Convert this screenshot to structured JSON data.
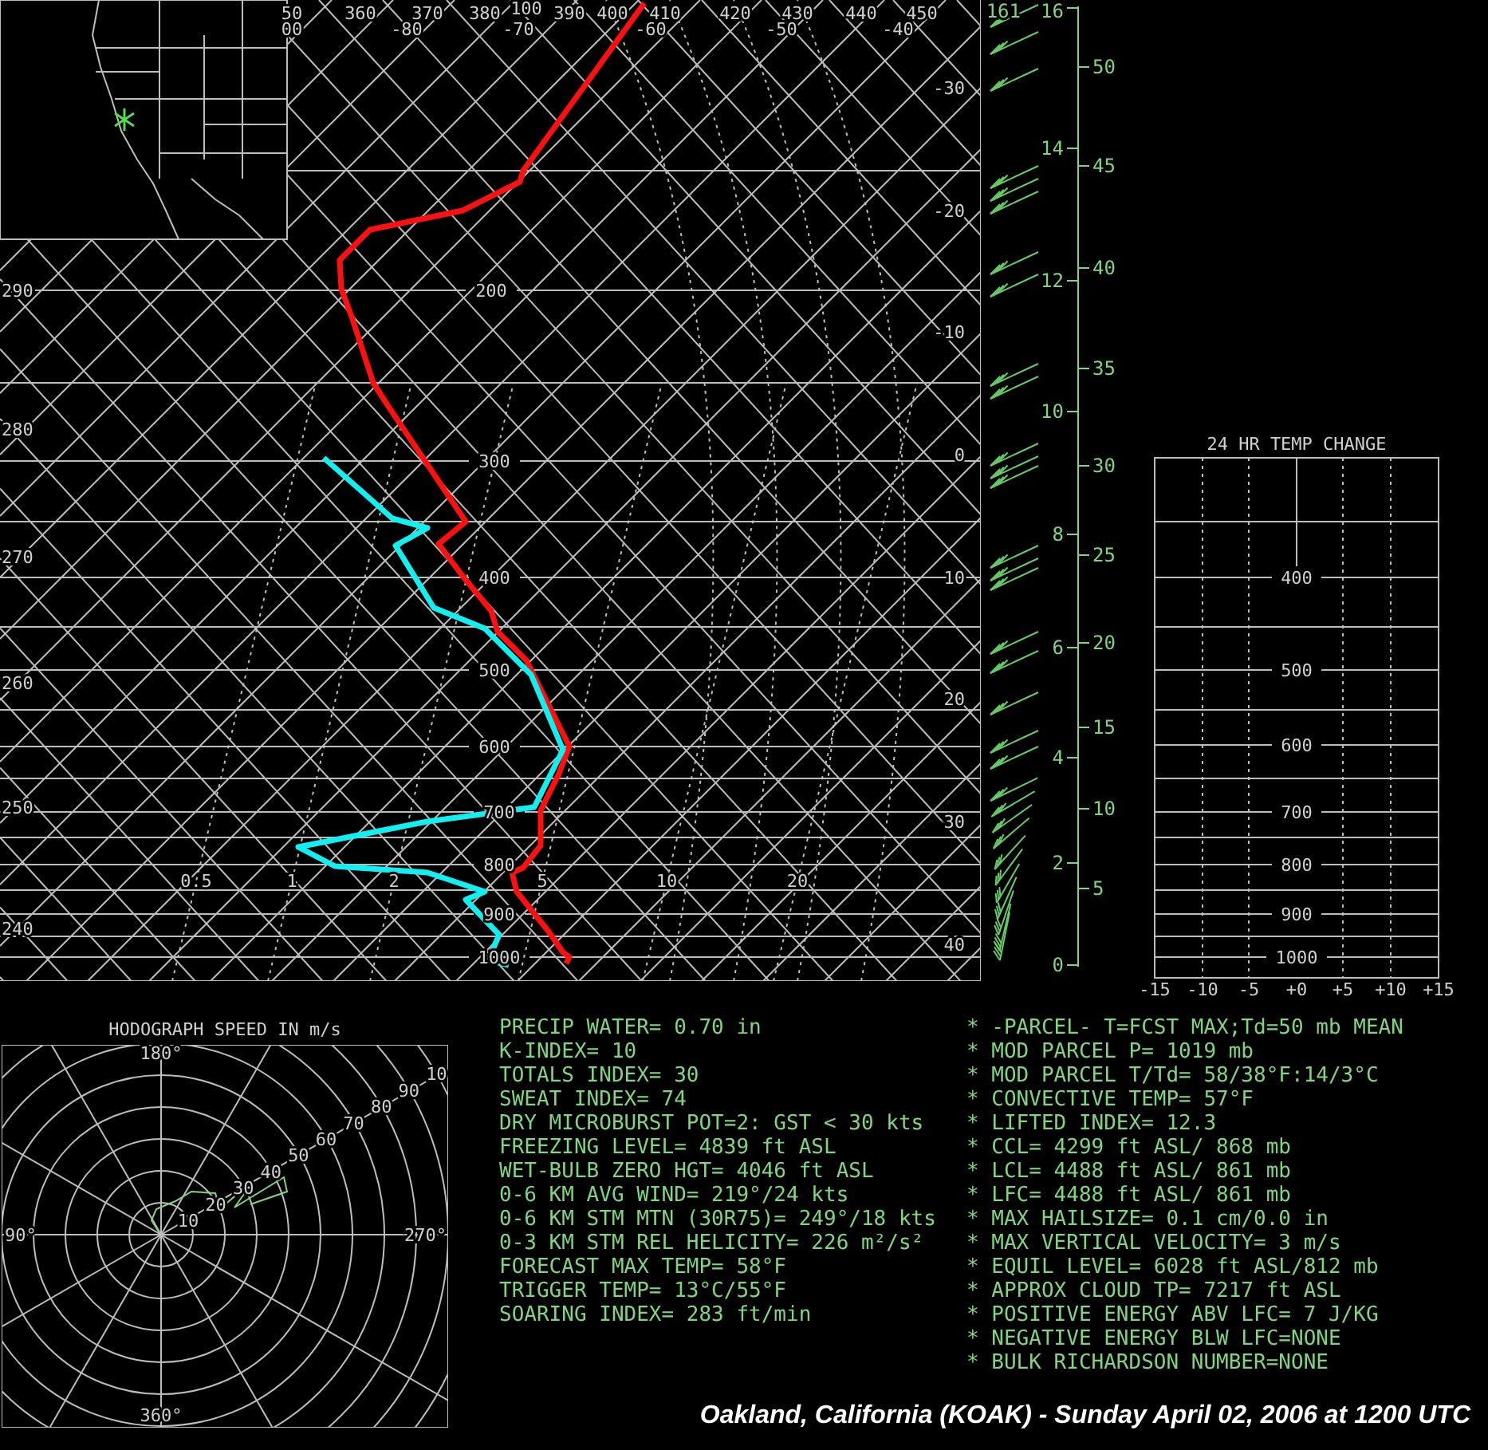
{
  "skew_t": {
    "pressure_labels": [
      "100",
      "200",
      "300",
      "400",
      "500",
      "600",
      "700",
      "800",
      "900",
      "1000"
    ],
    "theta_top_labels": [
      "50",
      "360",
      "370",
      "380",
      "390",
      "400",
      "410",
      "420",
      "430",
      "440",
      "450"
    ],
    "temp_top_labels": [
      "00",
      "-80",
      "-70",
      "-60",
      "-50",
      "-40"
    ],
    "temp_right_labels": [
      "-30",
      "-20",
      "-10",
      "0",
      "10",
      "20",
      "30",
      "40"
    ],
    "theta_left_labels": [
      "290",
      "280",
      "270",
      "260",
      "250",
      "240"
    ],
    "mixing_ratio_labels": [
      "0.5",
      "1",
      "2",
      "5",
      "10",
      "20"
    ]
  },
  "height_axis": {
    "top_reading": "161",
    "km_labels": [
      "16",
      "14",
      "12",
      "10",
      "8",
      "6",
      "4",
      "2",
      "0"
    ],
    "kft_labels": [
      "50",
      "45",
      "40",
      "35",
      "30",
      "25",
      "20",
      "15",
      "10",
      "5"
    ]
  },
  "temp_change_chart": {
    "title": "24 HR TEMP CHANGE",
    "pressure_labels": [
      "400",
      "500",
      "600",
      "700",
      "800",
      "900",
      "1000"
    ],
    "x_labels": [
      "-15",
      "-10",
      "-5",
      "+0",
      "+5",
      "+10",
      "+15"
    ]
  },
  "hodograph": {
    "title": "HODOGRAPH SPEED IN m/s",
    "direction_labels": [
      "180°",
      "90°",
      "270°",
      "360°"
    ],
    "speed_labels": [
      "10",
      "20",
      "30",
      "40",
      "50",
      "60",
      "70",
      "80",
      "90",
      "10"
    ]
  },
  "indices": [
    "PRECIP WATER= 0.70 in",
    "K-INDEX= 10",
    "TOTALS INDEX= 30",
    "SWEAT INDEX= 74",
    "DRY MICROBURST POT=2: GST < 30 kts",
    "FREEZING LEVEL= 4839 ft ASL",
    "WET-BULB ZERO HGT= 4046 ft ASL",
    "0-6 KM AVG WIND= 219°/24 kts",
    "0-6 KM STM MTN (30R75)= 249°/18 kts",
    "0-3 KM STM REL HELICITY= 226 m²/s²",
    "FORECAST MAX TEMP= 58°F",
    "TRIGGER TEMP= 13°C/55°F",
    "SOARING INDEX= 283 ft/min"
  ],
  "parcel_stats": [
    "* -PARCEL- T=FCST MAX;Td=50 mb MEAN",
    "* MOD PARCEL P= 1019 mb",
    "* MOD PARCEL T/Td= 58/38°F:14/3°C",
    "* CONVECTIVE TEMP= 57°F",
    "* LIFTED INDEX= 12.3",
    "* CCL= 4299 ft ASL/ 868 mb",
    "* LCL= 4488 ft ASL/ 861 mb",
    "* LFC= 4488 ft ASL/ 861 mb",
    "* MAX HAILSIZE= 0.1 cm/0.0 in",
    "* MAX VERTICAL VELOCITY= 3 m/s",
    "* EQUIL LEVEL= 6028 ft ASL/812 mb",
    "* APPROX CLOUD TP= 7217 ft ASL",
    "* POSITIVE ENERGY ABV LFC= 7 J/KG",
    "* NEGATIVE ENERGY BLW LFC=NONE",
    "* BULK RICHARDSON NUMBER=NONE"
  ],
  "caption": "Oakland, California (KOAK) - Sunday April 02, 2006 at 1200 UTC"
}
